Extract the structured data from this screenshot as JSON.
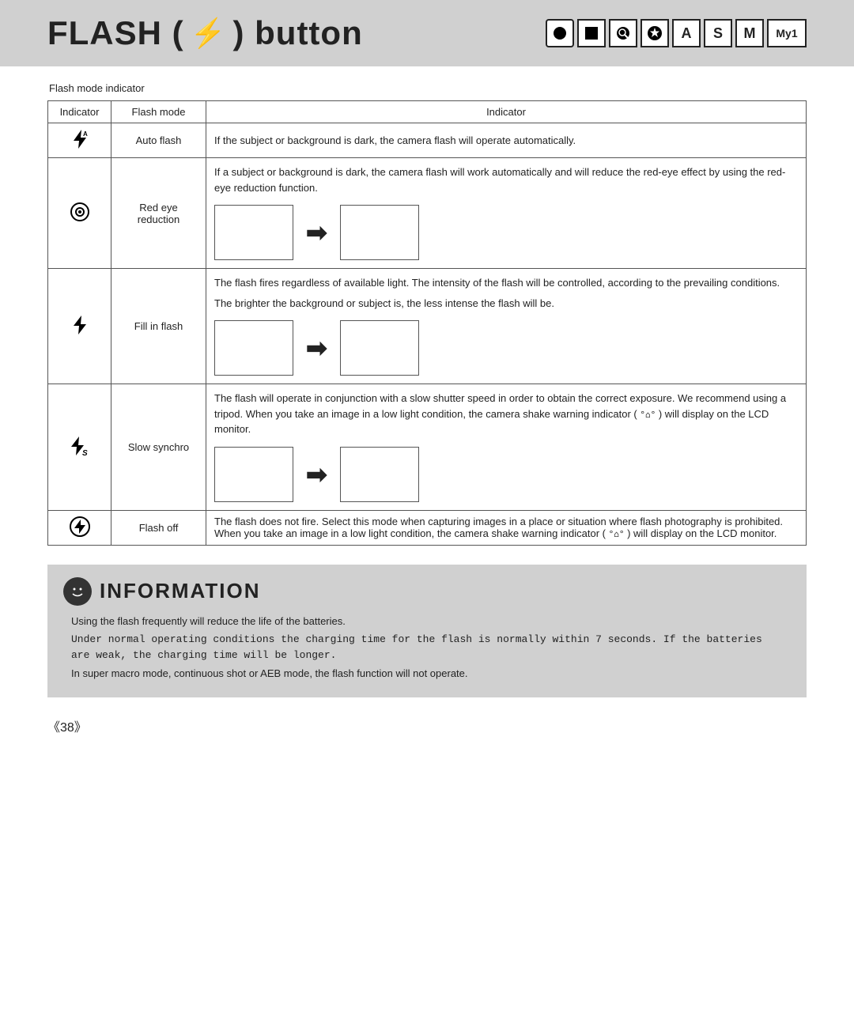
{
  "header": {
    "title": "FLASH (",
    "title_end": ") button",
    "bolt_symbol": "⚡",
    "mode_icons": [
      {
        "label": "●",
        "shape": "circle-filled",
        "id": "icon-program"
      },
      {
        "label": "■",
        "shape": "square-filled",
        "id": "icon-aperture"
      },
      {
        "label": "◉",
        "shape": "circle-dot",
        "id": "icon-scene"
      },
      {
        "label": "★",
        "shape": "star",
        "id": "icon-custom"
      },
      {
        "label": "A",
        "shape": "letter",
        "id": "icon-a"
      },
      {
        "label": "S",
        "shape": "letter",
        "id": "icon-s"
      },
      {
        "label": "M",
        "shape": "letter",
        "id": "icon-m"
      },
      {
        "label": "My1",
        "shape": "letter",
        "id": "icon-my1"
      }
    ]
  },
  "flash_mode_label": "Flash mode indicator",
  "table": {
    "headers": [
      "Indicator",
      "Flash mode",
      "Indicator"
    ],
    "rows": [
      {
        "indicator_symbol": "⚡",
        "mode": "Auto flash",
        "description": "If the subject or background is dark, the camera flash will operate automatically.",
        "has_diagram": false
      },
      {
        "indicator_symbol": "⊙",
        "mode": "Red eye\nreduction",
        "description": "If a subject or background is dark, the camera flash will work automatically and will reduce the red-eye effect by using the red-eye reduction function.",
        "has_diagram": true
      },
      {
        "indicator_symbol": "⚡",
        "mode": "Fill in flash",
        "description1": "The flash fires regardless of available light. The intensity of the flash will be controlled, according to the prevailing conditions.",
        "description2": "The brighter the background or subject is, the less intense the flash will be.",
        "has_diagram": true,
        "is_fill": true
      },
      {
        "indicator_symbol": "⚡S",
        "mode": "Slow synchro",
        "description": "The flash will operate in conjunction with a slow shutter speed in order to obtain the correct exposure. We recommend using a tripod. When you take an image in a low light condition, the camera shake warning indicator (",
        "shake_symbol": "°⌂°",
        "description_end": ") will display on the LCD monitor.",
        "has_diagram": true,
        "is_slow": true
      },
      {
        "indicator_symbol": "⊘",
        "mode": "Flash off",
        "description": "The flash does not fire. Select this mode when capturing images in a place or situation where flash photography is prohibited. When you take an image in a low light condition, the camera shake warning indicator (",
        "shake_symbol": "°⌂°",
        "description_end": ") will display on the LCD monitor.",
        "has_diagram": false
      }
    ]
  },
  "information": {
    "title": "INFORMATION",
    "icon": "i",
    "items": [
      "Using the flash frequently will reduce the life of the batteries.",
      "Under normal operating conditions the charging time for the flash is normally within 7 seconds. If the batteries are weak, the charging time will be longer.",
      "In super macro mode, continuous shot or AEB mode, the flash function will not operate."
    ]
  },
  "page_number": "《38》"
}
